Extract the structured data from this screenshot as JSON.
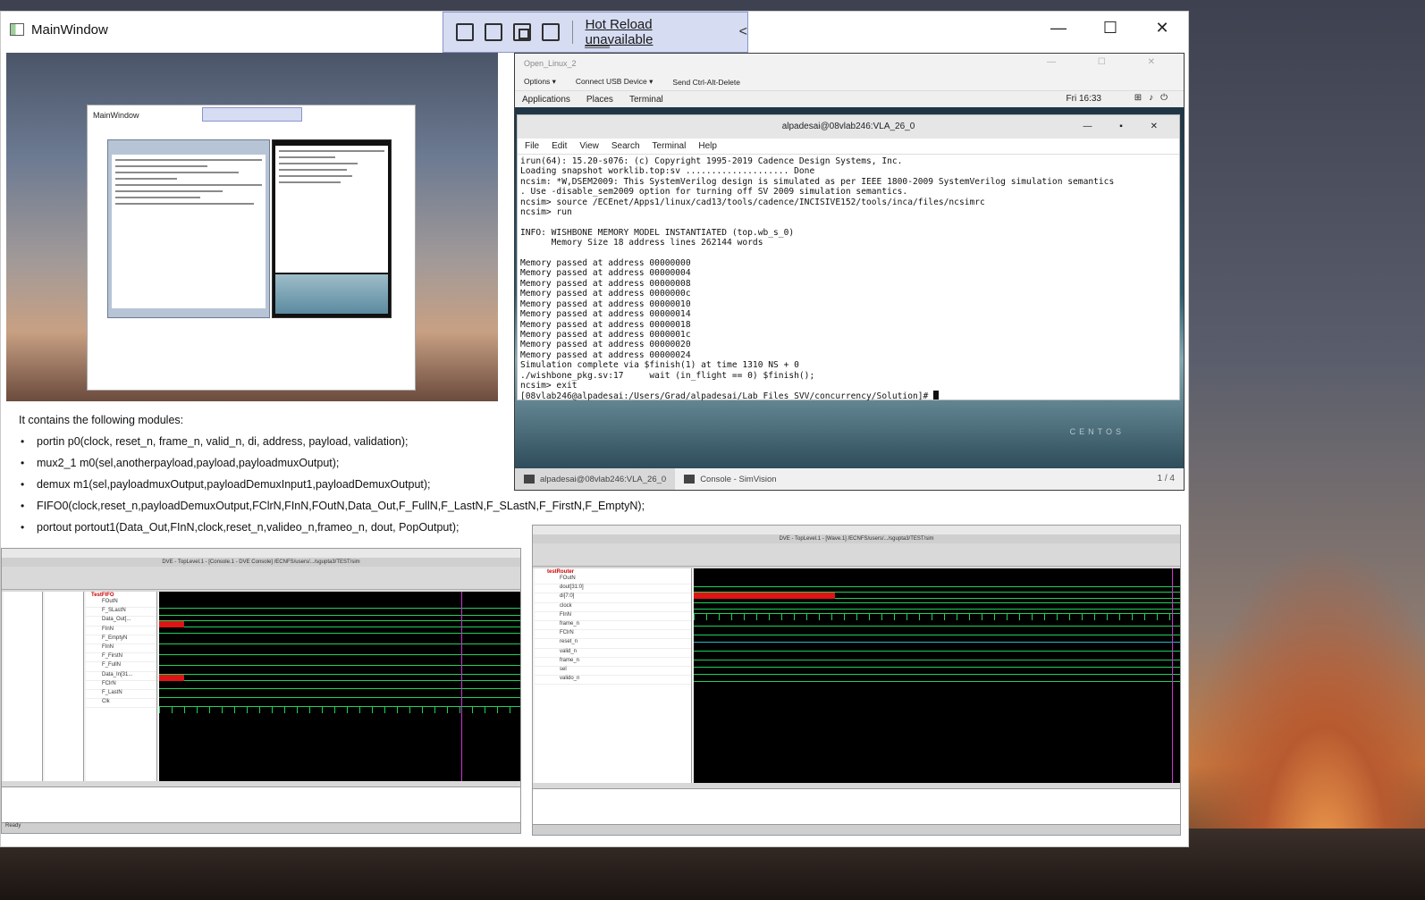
{
  "window": {
    "title": "MainWindow",
    "minimize": "—",
    "maximize": "☐",
    "close": "✕"
  },
  "hot_reload": {
    "label": "Hot Reload unavailable",
    "chevron": "<"
  },
  "document": {
    "intro": "It contains the following modules:",
    "modules": [
      "portin p0(clock, reset_n, frame_n, valid_n, di, address,  payload, validation);",
      "mux2_1 m0(sel,anotherpayload,payload,payloadmuxOutput);",
      "demux  m1(sel,payloadmuxOutput,payloadDemuxInput1,payloadDemuxOutput);",
      "FIFO0(clock,reset_n,payloadDemuxOutput,FClrN,FInN,FOutN,Data_Out,F_FullN,F_LastN,F_SLastN,F_FirstN,F_EmptyN);",
      "portout portout1(Data_Out,FInN,clock,reset_n,valideo_n,frameo_n,  dout, PopOutput);"
    ]
  },
  "vm": {
    "title": "Open_Linux_2",
    "toolbar": [
      "Options ▾",
      "Connect USB Device ▾",
      "Send Ctrl-Alt-Delete"
    ],
    "gnome_menu": [
      "Applications",
      "Places",
      "Terminal"
    ],
    "clock": "Fri 16:33",
    "terminal": {
      "title": "alpadesai@08vlab246:VLA_26_0",
      "menu": [
        "File",
        "Edit",
        "View",
        "Search",
        "Terminal",
        "Help"
      ],
      "lines": [
        "irun(64): 15.20-s076: (c) Copyright 1995-2019 Cadence Design Systems, Inc.",
        "Loading snapshot worklib.top:sv .................... Done",
        "ncsim: *W,DSEM2009: This SystemVerilog design is simulated as per IEEE 1800-2009 SystemVerilog simulation semantics",
        ". Use -disable_sem2009 option for turning off SV 2009 simulation semantics.",
        "ncsim> source /ECEnet/Apps1/linux/cad13/tools/cadence/INCISIVE152/tools/inca/files/ncsimrc",
        "ncsim> run",
        "",
        "INFO: WISHBONE MEMORY MODEL INSTANTIATED (top.wb_s_0)",
        "      Memory Size 18 address lines 262144 words",
        "",
        "Memory passed at address 00000000",
        "Memory passed at address 00000004",
        "Memory passed at address 00000008",
        "Memory passed at address 0000000c",
        "Memory passed at address 00000010",
        "Memory passed at address 00000014",
        "Memory passed at address 00000018",
        "Memory passed at address 0000001c",
        "Memory passed at address 00000020",
        "Memory passed at address 00000024",
        "Simulation complete via $finish(1) at time 1310 NS + 0",
        "./wishbone_pkg.sv:17     wait (in_flight == 0) $finish();",
        "ncsim> exit",
        "[08vlab246@alpadesai:/Users/Grad/alpadesai/Lab Files SVV/concurrency/Solution]# "
      ]
    },
    "centos": "CENTOS",
    "taskbar": [
      "alpadesai@08vlab246:VLA_26_0",
      "Console - SimVision"
    ],
    "pager": "1 / 4"
  },
  "dve_left": {
    "title": "DVE - TopLevel.1 - [Console.1 - DVE Console] /ECNFS/users/.../sgupta3/TEST/sim",
    "root": "TestFIFO",
    "signals": [
      "FOutN",
      "F_SLastN",
      "Data_Out[...",
      "FInN",
      "F_EmptyN",
      "FInN",
      "F_FirstN",
      "F_FullN",
      "Data_In[31...",
      "FClrN",
      "F_LastN",
      "Clk"
    ],
    "status": "Ready"
  },
  "dve_right": {
    "title": "DVE - TopLevel.1 - [Wave.1] /ECNFS/users/.../sgupta3/TEST/sim",
    "root": "testRouter",
    "signals": [
      "FOutN",
      "dout[31:0]",
      "di[7:0]",
      "clock",
      "FInN",
      "frame_n",
      "FClrN",
      "reset_n",
      "valid_n",
      "frame_n",
      "sel",
      "valido_n"
    ]
  }
}
